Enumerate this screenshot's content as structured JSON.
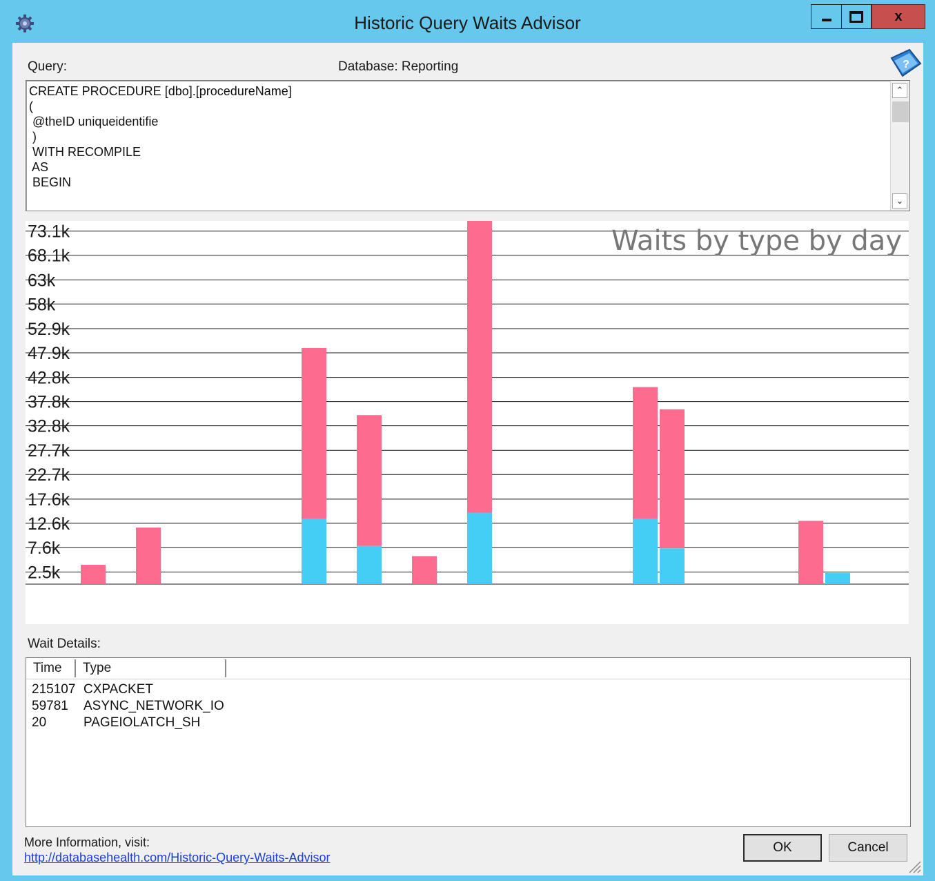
{
  "window": {
    "title": "Historic Query Waits Advisor",
    "minimize_icon": "minimize-icon",
    "maximize_icon": "maximize-icon",
    "close_label": "x"
  },
  "query": {
    "label": "Query:",
    "database_label": "Database: Reporting",
    "text": "CREATE PROCEDURE [dbo].[procedureName]\n(\n @theID uniqueidentifie\n )\n WITH RECOMPILE\n AS\n BEGIN"
  },
  "chart_data": {
    "type": "bar",
    "stacked": true,
    "title": "Waits by type by day",
    "y_ticks": [
      "73.1k",
      "68.1k",
      "63k",
      "58k",
      "52.9k",
      "47.9k",
      "42.8k",
      "37.8k",
      "32.8k",
      "27.7k",
      "22.7k",
      "17.6k",
      "12.6k",
      "7.6k",
      "2.5k"
    ],
    "y_tick_values": [
      73100,
      68100,
      63000,
      58000,
      52900,
      47900,
      42800,
      37800,
      32800,
      27700,
      22700,
      17600,
      12600,
      7600,
      2500
    ],
    "ylim": [
      0,
      75200
    ],
    "grid": true,
    "colors": {
      "pink": "#fd6b8f",
      "blue": "#44cef6"
    },
    "groups": [
      {
        "slot": 0,
        "bars": []
      },
      {
        "slot": 1,
        "bars": [
          {
            "blue": 0,
            "pink": 4000
          }
        ]
      },
      {
        "slot": 2,
        "bars": [
          {
            "blue": 0,
            "pink": 11700
          }
        ]
      },
      {
        "slot": 3,
        "bars": []
      },
      {
        "slot": 4,
        "bars": []
      },
      {
        "slot": 5,
        "bars": [
          {
            "blue": 13500,
            "pink": 35400
          }
        ]
      },
      {
        "slot": 6,
        "bars": [
          {
            "blue": 7900,
            "pink": 27100
          }
        ]
      },
      {
        "slot": 7,
        "bars": [
          {
            "blue": 0,
            "pink": 5800
          }
        ]
      },
      {
        "slot": 8,
        "bars": [
          {
            "blue": 14800,
            "pink": 60400
          }
        ]
      },
      {
        "slot": 9,
        "bars": []
      },
      {
        "slot": 10,
        "bars": []
      },
      {
        "slot": 11,
        "bars": [
          {
            "blue": 13500,
            "pink": 27300
          },
          {
            "blue": 7400,
            "pink": 28800
          }
        ]
      },
      {
        "slot": 12,
        "bars": []
      },
      {
        "slot": 13,
        "bars": []
      },
      {
        "slot": 14,
        "bars": [
          {
            "blue": 0,
            "pink": 13100
          },
          {
            "blue": 2300,
            "pink": 0
          }
        ]
      },
      {
        "slot": 15,
        "bars": []
      }
    ]
  },
  "details": {
    "label": "Wait Details:",
    "columns": [
      "Time",
      "Type"
    ],
    "rows": [
      {
        "time": "215107",
        "type": "CXPACKET"
      },
      {
        "time": "59781",
        "type": "ASYNC_NETWORK_IO"
      },
      {
        "time": "20",
        "type": "PAGEIOLATCH_SH"
      }
    ]
  },
  "footer": {
    "more_info": "More Information, visit:",
    "link": "http://databasehealth.com/Historic-Query-Waits-Advisor",
    "ok_label": "OK",
    "cancel_label": "Cancel"
  }
}
